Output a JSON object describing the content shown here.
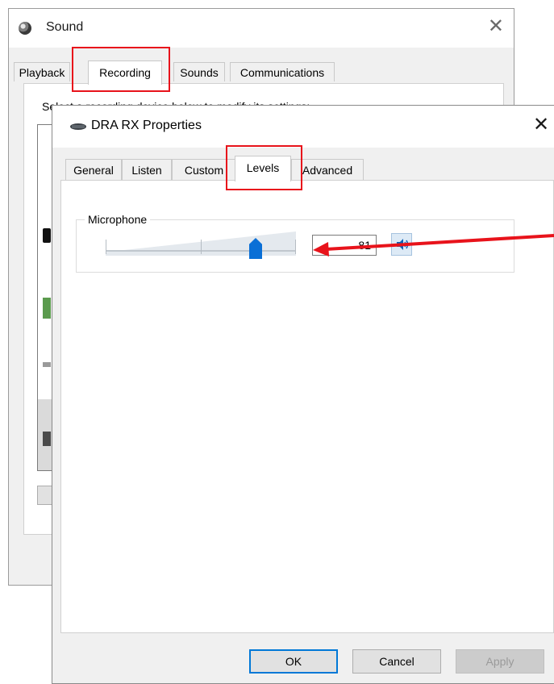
{
  "sound_window": {
    "title": "Sound",
    "close_glyph": "✕",
    "tabs": [
      {
        "label": "Playback"
      },
      {
        "label": "Recording",
        "active": true
      },
      {
        "label": "Sounds"
      },
      {
        "label": "Communications"
      }
    ],
    "instruction": "Select a recording device below to modify its settings:"
  },
  "properties_window": {
    "title": "DRA RX Properties",
    "close_glyph": "✕",
    "tabs": [
      {
        "label": "General"
      },
      {
        "label": "Listen"
      },
      {
        "label": "Custom"
      },
      {
        "label": "Levels",
        "active": true
      },
      {
        "label": "Advanced"
      }
    ],
    "levels": {
      "group_label": "Microphone",
      "slider_value_fraction": 0.81,
      "value_text": "81",
      "speaker_icon": "speaker-volume-icon"
    },
    "buttons": {
      "ok": "OK",
      "cancel": "Cancel",
      "apply": "Apply"
    }
  },
  "colors": {
    "annotation": "#e8131b",
    "accent": "#0078d7",
    "slider_thumb": "#0a6fd6"
  }
}
